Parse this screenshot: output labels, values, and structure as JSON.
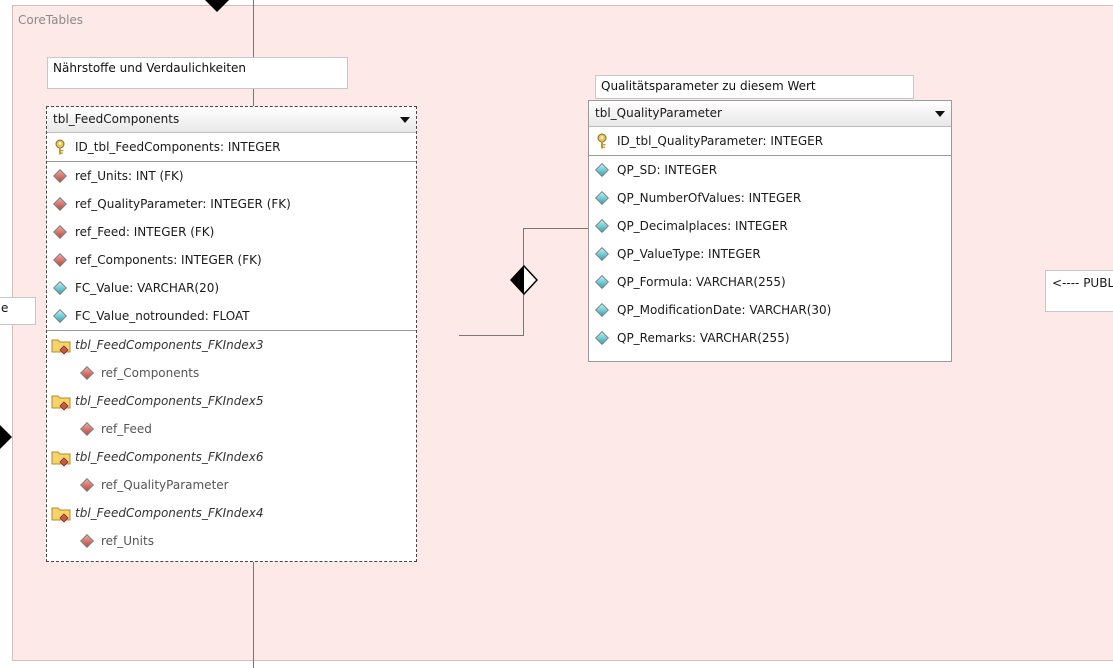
{
  "region": {
    "label": "CoreTables"
  },
  "notes": {
    "feed_components_note": "Nährstoffe und  Verdaulichkeiten",
    "quality_note": "Qualitätsparameter zu diesem Wert",
    "left_partial": "e",
    "right_partial": "<---- PUBL"
  },
  "feed_components": {
    "name": "tbl_FeedComponents",
    "pk": "ID_tbl_FeedComponents: INTEGER",
    "columns": [
      "ref_Units: INT (FK)",
      "ref_QualityParameter: INTEGER (FK)",
      "ref_Feed: INTEGER (FK)",
      "ref_Components: INTEGER (FK)",
      "FC_Value: VARCHAR(20)",
      "FC_Value_notrounded: FLOAT"
    ],
    "indexes": [
      {
        "name": "tbl_FeedComponents_FKIndex3",
        "column": "ref_Components"
      },
      {
        "name": "tbl_FeedComponents_FKIndex5",
        "column": "ref_Feed"
      },
      {
        "name": "tbl_FeedComponents_FKIndex6",
        "column": "ref_QualityParameter"
      },
      {
        "name": "tbl_FeedComponents_FKIndex4",
        "column": "ref_Units"
      }
    ]
  },
  "quality_parameter": {
    "name": "tbl_QualityParameter",
    "pk": "ID_tbl_QualityParameter: INTEGER",
    "columns": [
      "QP_SD: INTEGER",
      "QP_NumberOfValues: INTEGER",
      "QP_Decimalplaces: INTEGER",
      "QP_ValueType: INTEGER",
      "QP_Formula: VARCHAR(255)",
      "QP_ModificationDate: VARCHAR(30)",
      "QP_Remarks: VARCHAR(255)"
    ]
  },
  "icons": {
    "primary_key": "key-icon",
    "foreign_key": "fk-diamond-icon",
    "attribute": "attribute-diamond-icon",
    "index": "index-folder-icon"
  },
  "colors": {
    "region_bg": "#fde9e7",
    "fk_icon": "#c9584e",
    "attr_icon": "#3bb3c2"
  }
}
